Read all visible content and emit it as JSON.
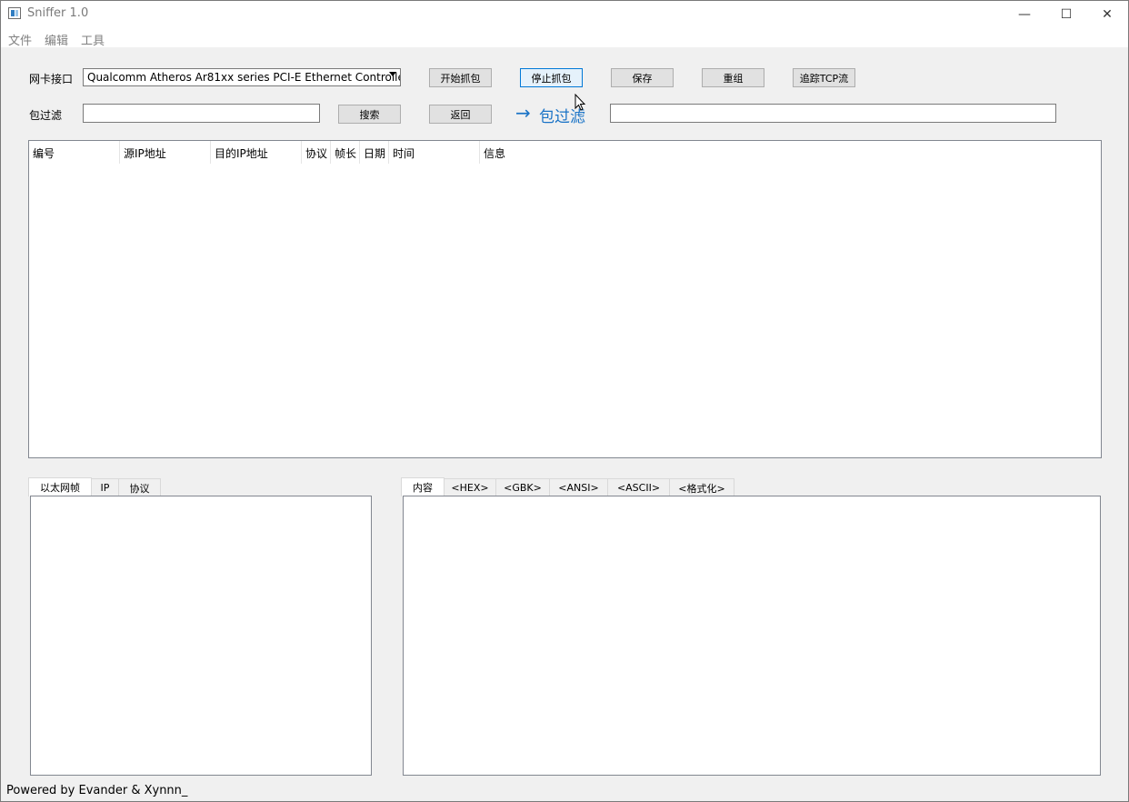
{
  "window": {
    "title": "Sniffer 1.0",
    "min_glyph": "—",
    "max_glyph": "☐",
    "close_glyph": "✕"
  },
  "menu": {
    "file": "文件",
    "edit": "编辑",
    "tools": "工具"
  },
  "toolbar": {
    "nic_label": "网卡接口",
    "nic_selected": "Qualcomm Atheros Ar81xx series PCI-E Ethernet Controller",
    "start_label": "开始抓包",
    "stop_label": "停止抓包",
    "save_label": "保存",
    "reassemble_label": "重组",
    "tcp_follow_label": "追踪TCP流"
  },
  "filter": {
    "label": "包过滤",
    "search_label": "搜索",
    "back_label": "返回",
    "arrow_glyph": "→",
    "arrow_text": "包过滤",
    "filter_value": "",
    "result_value": ""
  },
  "packet_table": {
    "columns": [
      "编号",
      "源IP地址",
      "目的IP地址",
      "协议",
      "帧长",
      "日期",
      "时间",
      "信息"
    ],
    "rows": []
  },
  "detail_tabs": {
    "items": [
      "以太网帧",
      "IP",
      "协议"
    ],
    "active": 0
  },
  "content_tabs": {
    "items": [
      "内容",
      "<HEX>",
      "<GBK>",
      "<ANSI>",
      "<ASCII>",
      "<格式化>"
    ],
    "active": 0
  },
  "status": {
    "text": "Powered by Evander & Xynnn_"
  }
}
